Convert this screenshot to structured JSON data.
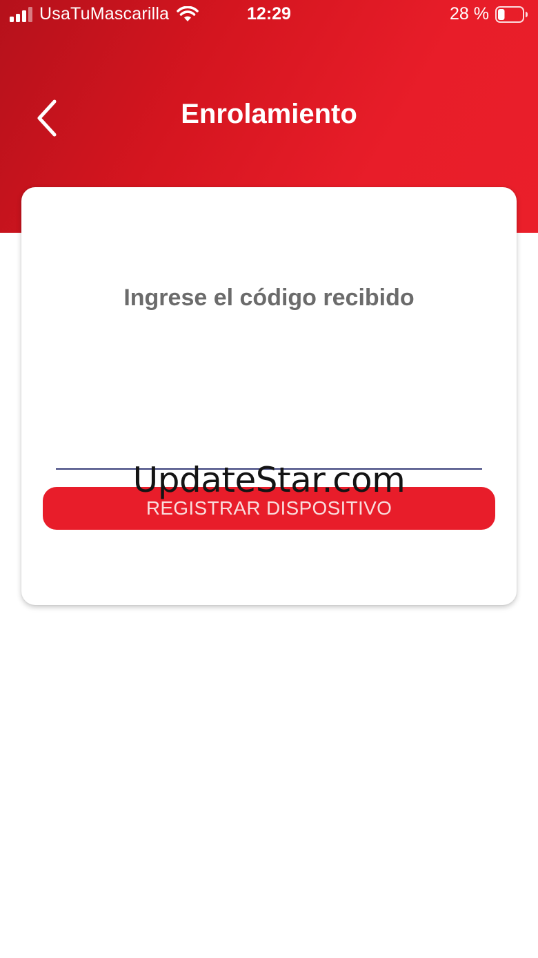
{
  "status_bar": {
    "carrier": "UsaTuMascarilla",
    "time": "12:29",
    "battery_percent": "28 %",
    "battery_level": 0.28,
    "signal_icon": "cellular-signal-icon",
    "wifi_icon": "wifi-icon",
    "battery_icon": "battery-icon"
  },
  "header": {
    "back_icon": "chevron-left-icon",
    "title": "Enrolamiento"
  },
  "card": {
    "instruction": "Ingrese el código recibido",
    "code_input": {
      "value": "",
      "placeholder": ""
    },
    "register_button_label": "REGISTRAR DISPOSITIVO"
  },
  "watermark": "UpdateStar.com",
  "colors": {
    "brand_red": "#e81d2a",
    "brand_red_dark": "#b5111b",
    "input_underline": "#3a3f7a",
    "instruction_text": "#6b6b6b"
  }
}
